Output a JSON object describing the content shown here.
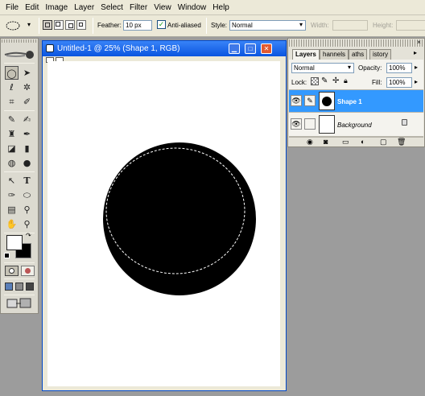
{
  "menu": [
    "File",
    "Edit",
    "Image",
    "Layer",
    "Select",
    "Filter",
    "View",
    "Window",
    "Help"
  ],
  "options": {
    "feather_label": "Feather:",
    "feather_value": "10 px",
    "anti_aliased_label": "Anti-aliased",
    "anti_aliased_checked": true,
    "style_label": "Style:",
    "style_value": "Normal",
    "width_label": "Width:",
    "height_label": "Height:"
  },
  "document": {
    "title": "Untitled-1 @ 25% (Shape 1, RGB)",
    "shape_color": "#000000",
    "selection": "dashed circular marquee"
  },
  "layers_panel": {
    "tabs": [
      "Layers",
      "Channels",
      "Paths",
      "History"
    ],
    "tabs_visible": [
      "Layers",
      "hannels",
      "aths",
      "istory"
    ],
    "active_tab": "Layers",
    "blend_mode": "Normal",
    "opacity_label": "Opacity:",
    "opacity_value": "100%",
    "lock_label": "Lock:",
    "fill_label": "Fill:",
    "fill_value": "100%",
    "layers": [
      {
        "name": "Shape 1",
        "selected": true
      },
      {
        "name": "Background",
        "selected": false,
        "locked": true
      }
    ],
    "selected_color": "#3399ff"
  },
  "toolbox": {
    "foreground_color": "#ffffff",
    "background_color": "#000000"
  }
}
